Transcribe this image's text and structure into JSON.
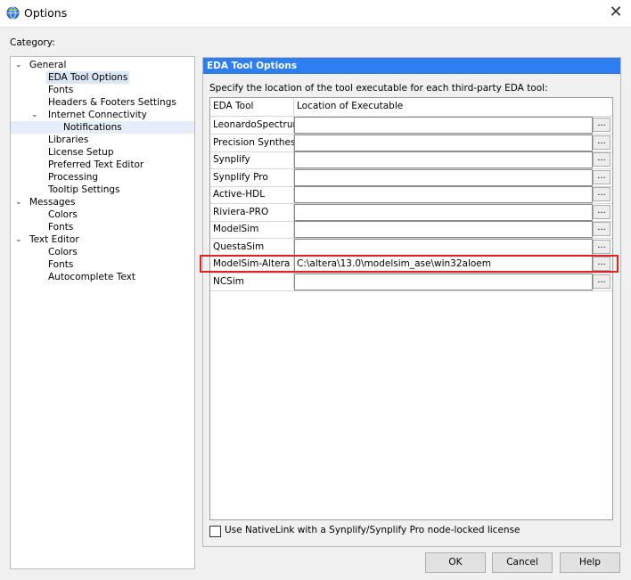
{
  "window": {
    "title": "Options",
    "close_glyph": "✕"
  },
  "category_label": "Category:",
  "tree": [
    {
      "label": "General",
      "level": 0,
      "expanded": true
    },
    {
      "label": "EDA Tool Options",
      "level": 1,
      "selected": true
    },
    {
      "label": "Fonts",
      "level": 1
    },
    {
      "label": "Headers & Footers Settings",
      "level": 1
    },
    {
      "label": "Internet Connectivity",
      "level": 1,
      "expanded": true
    },
    {
      "label": "Notifications",
      "level": 2
    },
    {
      "label": "Libraries",
      "level": 1
    },
    {
      "label": "License Setup",
      "level": 1
    },
    {
      "label": "Preferred Text Editor",
      "level": 1
    },
    {
      "label": "Processing",
      "level": 1
    },
    {
      "label": "Tooltip Settings",
      "level": 1
    },
    {
      "label": "Messages",
      "level": 0,
      "expanded": true
    },
    {
      "label": "Colors",
      "level": 1
    },
    {
      "label": "Fonts",
      "level": 1
    },
    {
      "label": "Text Editor",
      "level": 0,
      "expanded": true
    },
    {
      "label": "Colors",
      "level": 1
    },
    {
      "label": "Fonts",
      "level": 1
    },
    {
      "label": "Autocomplete Text",
      "level": 1
    }
  ],
  "panel": {
    "header": "EDA Tool Options",
    "description": "Specify the location of the tool executable for each third-party EDA tool:",
    "columns": [
      "EDA Tool",
      "Location of Executable"
    ],
    "tools": [
      {
        "name": "LeonardoSpectrum",
        "path": ""
      },
      {
        "name": "Precision Synthesis",
        "path": ""
      },
      {
        "name": "Synplify",
        "path": ""
      },
      {
        "name": "Synplify Pro",
        "path": ""
      },
      {
        "name": "Active-HDL",
        "path": ""
      },
      {
        "name": "Riviera-PRO",
        "path": ""
      },
      {
        "name": "ModelSim",
        "path": ""
      },
      {
        "name": "QuestaSim",
        "path": ""
      },
      {
        "name": "ModelSim-Altera",
        "path": "C:\\altera\\13.0\\modelsim_ase\\win32aloem"
      },
      {
        "name": "NCSim",
        "path": ""
      }
    ],
    "browse_label": "...",
    "nativelink_checkbox": {
      "label": "Use NativeLink with a Synplify/Synplify Pro node-locked license",
      "checked": false
    }
  },
  "buttons": {
    "ok": "OK",
    "cancel": "Cancel",
    "help": "Help"
  },
  "colors": {
    "header_bg": "#2d7ff1",
    "highlight_box": "#e02222",
    "selection": "#dbe6f4"
  }
}
